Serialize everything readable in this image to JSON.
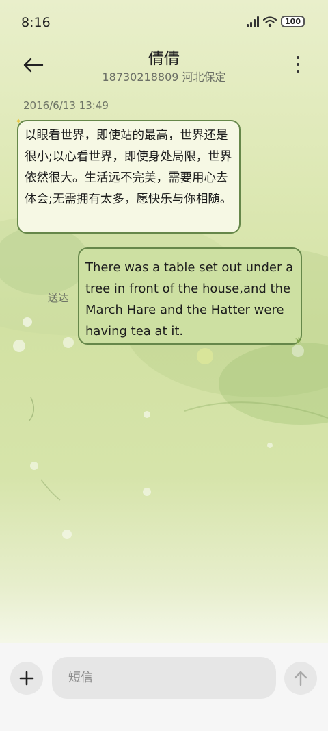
{
  "status_bar": {
    "time": "8:16",
    "battery": "100"
  },
  "header": {
    "contact_name": "倩倩",
    "contact_subtitle": "18730218809 河北保定"
  },
  "conversation": {
    "timestamp": "2016/6/13 13:49",
    "messages": [
      {
        "direction": "incoming",
        "text": "以眼看世界，即使站的最高，世界还是很小;以心看世界，即使身处局限，世界依然很大。生活远不完美，需要用心去体会;无需拥有太多，愿快乐与你相随。"
      },
      {
        "direction": "outgoing",
        "text": "There was a table set out under a tree in front of the house,and the March Hare and the Hatter were having tea at it.",
        "status": "送达"
      }
    ]
  },
  "composer": {
    "placeholder": "短信"
  },
  "icons": {
    "back": "arrow-left-icon",
    "more": "more-vertical-icon",
    "add": "plus-icon",
    "send": "arrow-up-icon",
    "signal": "signal-icon",
    "wifi": "wifi-icon",
    "battery": "battery-icon"
  },
  "colors": {
    "incoming_bubble": "#f6f8e4",
    "outgoing_bubble": "#cde0a2",
    "bubble_border": "#66874a",
    "input_bar": "#f6f6f6"
  }
}
